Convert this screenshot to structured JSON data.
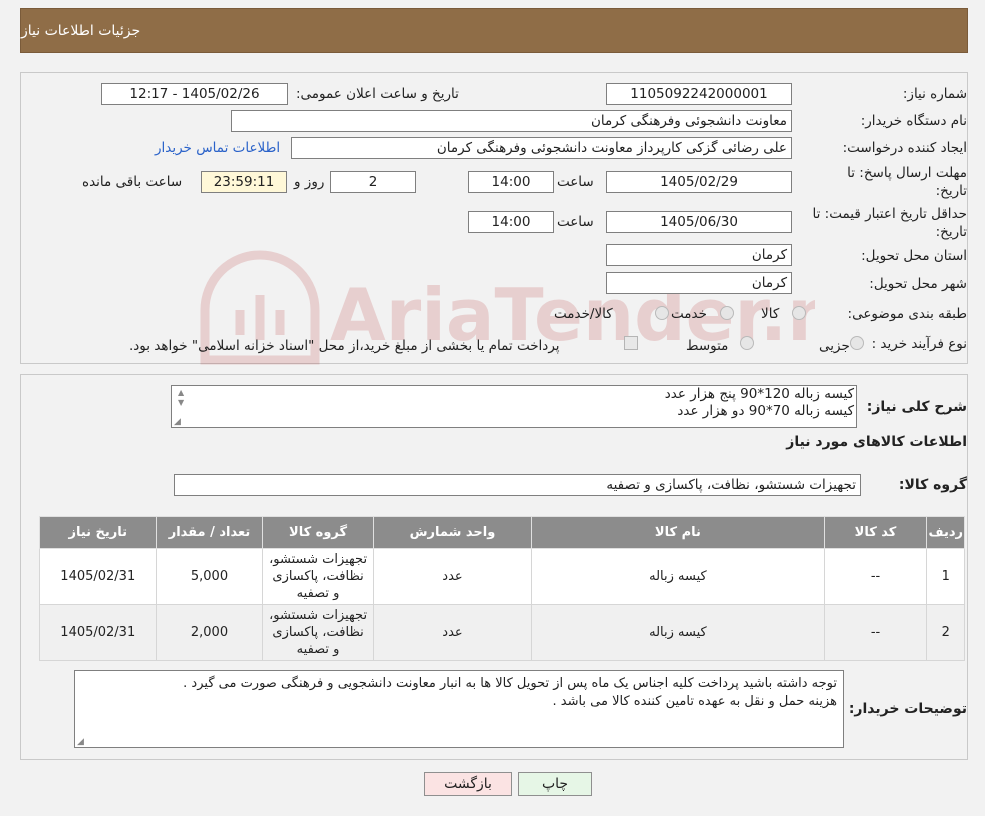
{
  "header": {
    "title": "جزئیات اطلاعات نیاز"
  },
  "labels": {
    "need_number": "شماره نیاز:",
    "announce_datetime": "تاریخ و ساعت اعلان عمومی:",
    "buyer_org": "نام دستگاه خریدار:",
    "requester": "ایجاد کننده درخواست:",
    "reply_deadline_l1": "مهلت ارسال پاسخ: تا",
    "reply_deadline_l2": "تاریخ:",
    "min_validity_l1": "حداقل تاریخ اعتبار قیمت: تا",
    "min_validity_l2": "تاریخ:",
    "time": "ساعت",
    "day_and": "روز و",
    "hours_left": "ساعت باقی مانده",
    "province": "استان محل تحویل:",
    "city": "شهر محل تحویل:",
    "category": "طبقه بندی موضوعی:",
    "process": "نوع فرآیند خرید :",
    "description": "شرح کلی نیاز:",
    "goods_info": "اطلاعات کالاهای مورد نیاز",
    "goods_group": "گروه کالا:",
    "buyer_notes": "توضیحات خریدار:"
  },
  "values": {
    "need_number": "1105092242000001",
    "announce_datetime": "1405/02/26 - 12:17",
    "buyer_org": "معاونت دانشجوئی وفرهنگی کرمان",
    "requester": "علی رضائی گزکی کارپرداز معاونت دانشجوئی وفرهنگی کرمان",
    "contact_link": "اطلاعات تماس خریدار",
    "reply_date": "1405/02/29",
    "reply_time": "14:00",
    "days_left": "2",
    "time_left": "23:59:11",
    "validity_date": "1405/06/30",
    "validity_time": "14:00",
    "province": "کرمان",
    "city": "کرمان"
  },
  "category_options": [
    "کالا",
    "خدمت",
    "کالا/خدمت"
  ],
  "process_options": [
    "جزیی",
    "متوسط"
  ],
  "process_note": "پرداخت تمام یا بخشی از مبلغ خرید،از محل \"اسناد خزانه اسلامی\" خواهد بود.",
  "description_lines": [
    "کیسه زباله 120*90 پنج هزار عدد",
    "کیسه زباله 70*90 دو هزار عدد"
  ],
  "goods_group_value": "تجهیزات شستشو، نظافت، پاکسازی و تصفیه",
  "table": {
    "headers": [
      "ردیف",
      "کد کالا",
      "نام کالا",
      "واحد شمارش",
      "گروه کالا",
      "تعداد / مقدار",
      "تاریخ نیاز"
    ],
    "rows": [
      [
        "1",
        "--",
        "کیسه زباله",
        "عدد",
        "تجهیزات شستشو، نظافت، پاکسازی و تصفیه",
        "5,000",
        "1405/02/31"
      ],
      [
        "2",
        "--",
        "کیسه زباله",
        "عدد",
        "تجهیزات شستشو، نظافت، پاکسازی و تصفیه",
        "2,000",
        "1405/02/31"
      ]
    ]
  },
  "buyer_notes_lines": [
    "توجه داشته باشید پرداخت کلیه اجناس یک ماه پس از تحویل کالا ها به انبار معاونت دانشجویی و فرهنگی صورت می گیرد .",
    "هزینه حمل و نقل به عهده تامین کننده کالا می باشد ."
  ],
  "buttons": {
    "print": "چاپ",
    "back": "بازگشت"
  },
  "colors": {
    "header_bg": "#8f6d47",
    "table_header": "#8c8c8c",
    "link": "#2a62c9",
    "back_button": "#fbe3e3",
    "print_button": "#e6f6e6"
  }
}
